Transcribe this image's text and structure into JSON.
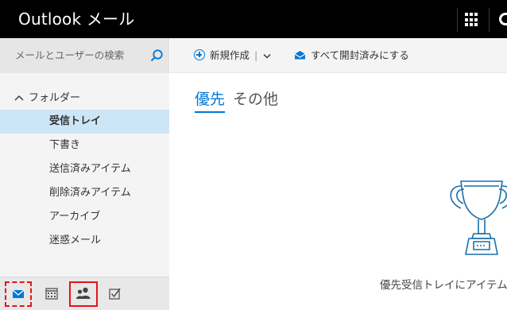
{
  "app": {
    "title": "Outlook メール"
  },
  "search": {
    "placeholder": "メールとユーザーの検索"
  },
  "folders": {
    "header": "フォルダー",
    "items": [
      {
        "label": "受信トレイ",
        "selected": true
      },
      {
        "label": "下書き"
      },
      {
        "label": "送信済みアイテム"
      },
      {
        "label": "削除済みアイテム"
      },
      {
        "label": "アーカイブ"
      },
      {
        "label": "迷惑メール"
      }
    ]
  },
  "commands": {
    "new_label": "新規作成",
    "new_sep": "|",
    "mark_all_read": "すべて開封済みにする"
  },
  "pivot": {
    "focused": "優先",
    "other": "その他"
  },
  "empty_state": {
    "message": "優先受信トレイにアイテムはありません"
  },
  "bottom_nav": [
    "mail-icon",
    "calendar-icon",
    "people-icon",
    "tasks-icon"
  ],
  "colors": {
    "accent": "#0078d7",
    "selected_bg": "#cde6f7",
    "highlight": "#e3141d",
    "topbar": "#000000"
  }
}
